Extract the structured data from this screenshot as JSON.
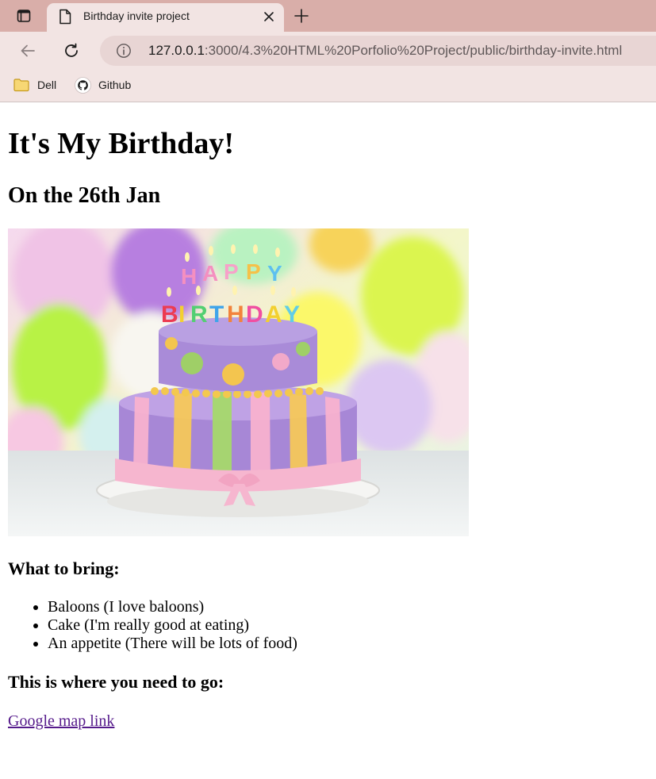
{
  "browser": {
    "tab_title": "Birthday invite project",
    "url_host": "127.0.0.1",
    "url_rest": ":3000/4.3%20HTML%20Porfolio%20Project/public/birthday-invite.html",
    "bookmarks": [
      "Dell",
      "Github"
    ],
    "colors": {
      "tabstrip": "#d9aea9",
      "toolbar": "#f2e4e3",
      "omnibox": "#e8d5d4"
    }
  },
  "page": {
    "title": "It's My Birthday!",
    "date_heading": "On the 26th Jan",
    "bring_heading": "What to bring:",
    "bring_items": [
      "Baloons (I love baloons)",
      "Cake (I'm really good at eating)",
      "An appetite (There will be lots of food)"
    ],
    "go_heading": "This is where you need to go:",
    "map_link": "Google map link",
    "link_color": "#551a8b"
  }
}
